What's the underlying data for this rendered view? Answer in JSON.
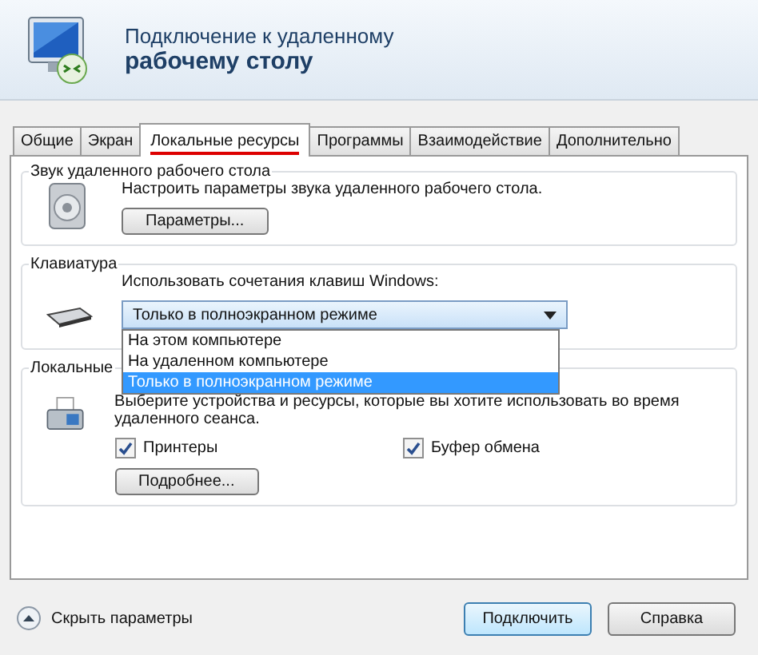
{
  "window": {
    "title_line1": "Подключение к удаленному",
    "title_line2": "рабочему столу"
  },
  "tabs": [
    {
      "label": "Общие",
      "selected": false
    },
    {
      "label": "Экран",
      "selected": false
    },
    {
      "label": "Локальные ресурсы",
      "selected": true
    },
    {
      "label": "Программы",
      "selected": false
    },
    {
      "label": "Взаимодействие",
      "selected": false
    },
    {
      "label": "Дополнительно",
      "selected": false
    }
  ],
  "sound": {
    "title": "Звук удаленного рабочего стола",
    "text": "Настроить параметры звука удаленного рабочего стола.",
    "button": "Параметры..."
  },
  "keyboard": {
    "title": "Клавиатура",
    "text": "Использовать сочетания клавиш Windows:",
    "value": "Только в полноэкранном режиме",
    "expanded": true,
    "options": [
      {
        "label": "На этом компьютере",
        "selected": false
      },
      {
        "label": "На удаленном компьютере",
        "selected": false
      },
      {
        "label": "Только в полноэкранном режиме",
        "selected": true
      }
    ]
  },
  "local": {
    "title": "Локальные",
    "text": "Выберите устройства и ресурсы, которые вы хотите использовать во время удаленного сеанса.",
    "checks": [
      {
        "label": "Принтеры",
        "checked": true
      },
      {
        "label": "Буфер обмена",
        "checked": true
      }
    ],
    "button": "Подробнее..."
  },
  "footer": {
    "toggle": "Скрыть параметры",
    "buttons": [
      {
        "label": "Подключить",
        "kind": "default"
      },
      {
        "label": "Справка",
        "kind": "normal"
      }
    ]
  }
}
